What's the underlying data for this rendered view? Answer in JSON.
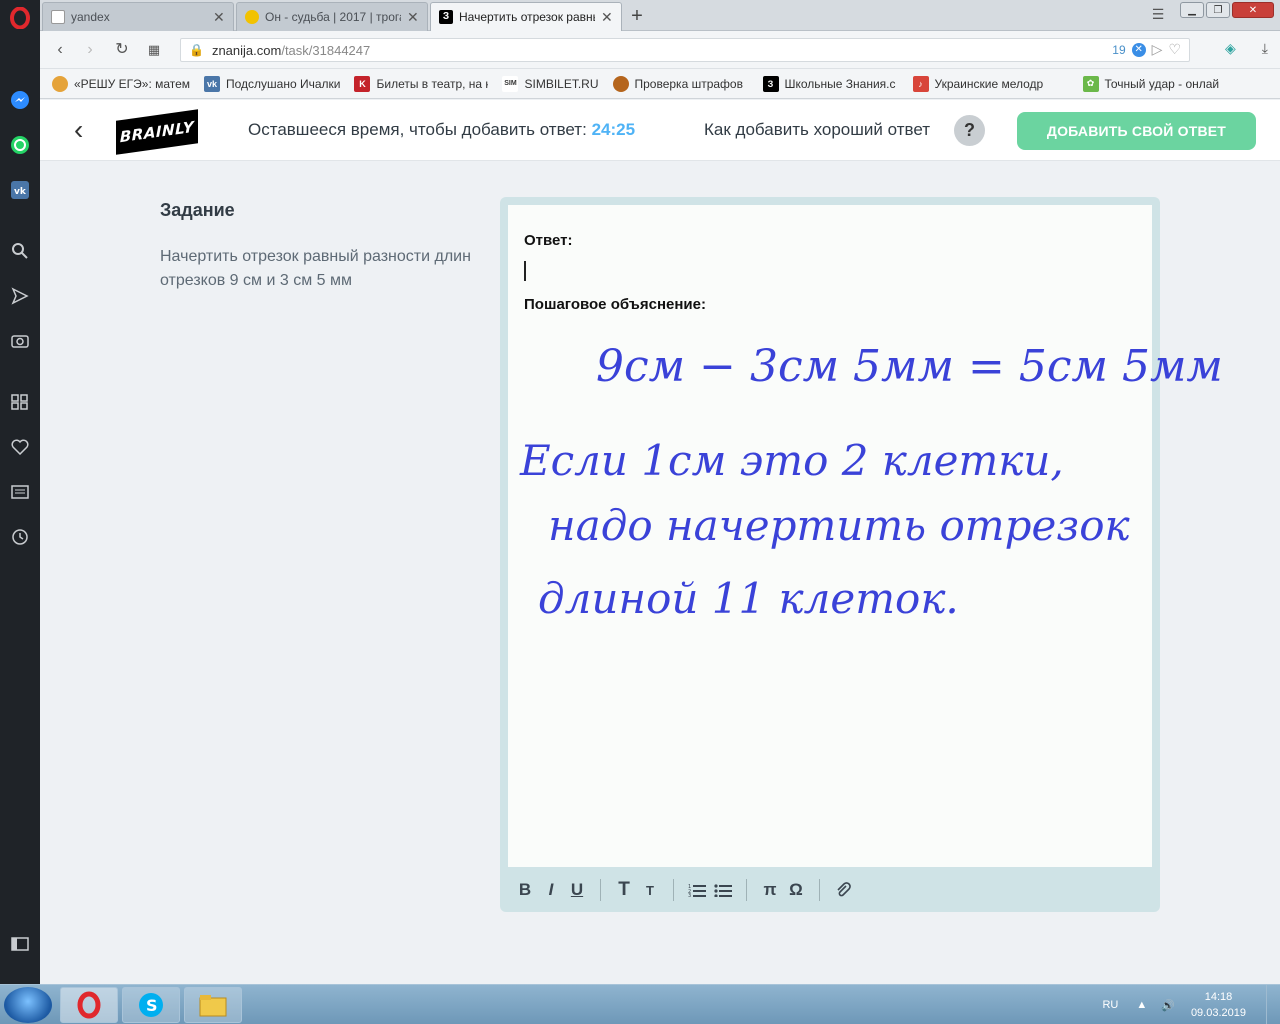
{
  "browser": {
    "tabs": [
      {
        "title": "yandex",
        "active": false
      },
      {
        "title": "Он - судьба | 2017 | трога",
        "active": false
      },
      {
        "title": "Начертить отрезок равны",
        "active": true
      }
    ],
    "url": {
      "host": "znanija.com",
      "path": "/task/31844247"
    },
    "badge_count": "19",
    "bookmarks": [
      "«РЕШУ ЕГЭ»: матема",
      "Подслушано Ичалки",
      "Билеты в театр, на к",
      "SIMBILET.RU",
      "Проверка штрафов",
      "Школьные Знания.c",
      "Украинские мелодр",
      "Точный удар - онлай"
    ]
  },
  "header": {
    "logo": "BRAINLY",
    "timer_label": "Оставшееся время, чтобы добавить ответ:",
    "timer_value": "24:25",
    "howto_label": "Как добавить хороший ответ",
    "help_symbol": "?",
    "add_answer_label": "ДОБАВИТЬ СВОЙ ОТВЕТ"
  },
  "task": {
    "title": "Задание",
    "text": "Начертить отрезок равный разности длин отрезков 9 см и 3 см 5 мм"
  },
  "editor": {
    "answer_label": "Ответ:",
    "explanation_label": "Пошаговое объяснение:",
    "handwriting": {
      "line1": "9см − 3см 5мм = 5см 5мм",
      "line2": "Если 1см это 2 клетки,",
      "line3": "надо начертить отрезок",
      "line4": "длиной 11 клеток."
    },
    "toolbar": {
      "bold": "B",
      "italic": "I",
      "underline": "U",
      "heading_big": "T",
      "heading_small": "T",
      "pi": "π",
      "omega": "Ω"
    }
  },
  "taskbar": {
    "lang": "RU",
    "time": "14:18",
    "date": "09.03.2019"
  },
  "colors": {
    "brainly_green": "#6bd4a0",
    "timer_blue": "#4fb3f6",
    "ink_blue": "#3a42d8",
    "editor_frame": "#cfe3e6"
  }
}
